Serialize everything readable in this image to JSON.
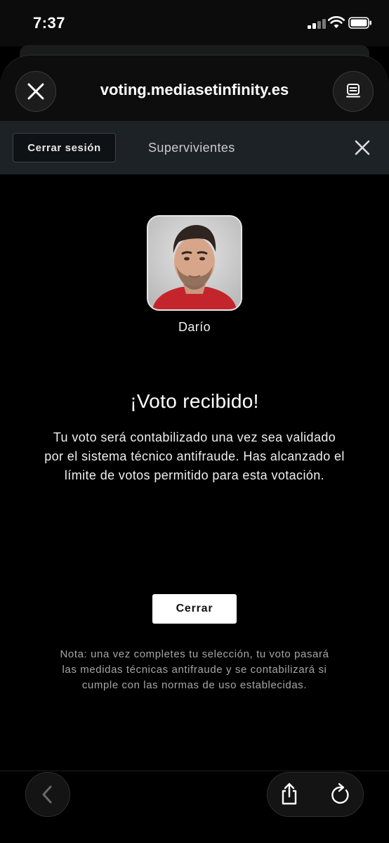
{
  "status_bar": {
    "time": "7:37"
  },
  "browser": {
    "url": "voting.mediasetinfinity.es"
  },
  "header": {
    "logout_label": "Cerrar sesión",
    "title": "Supervivientes"
  },
  "candidate": {
    "name": "Darío"
  },
  "result": {
    "title": "¡Voto recibido!",
    "message": "Tu voto será contabilizado una vez sea validado por el sistema técnico antifraude. Has alcanzado el límite de votos permitido para esta votación.",
    "close_label": "Cerrar",
    "note": "Nota: una vez completes tu selección, tu voto pasará las medidas técnicas antifraude y se contabilizará si cumple con las normas de uso establecidas."
  },
  "icons": {
    "close": "close-icon",
    "reader": "reader-mode-icon",
    "back": "chevron-left-icon",
    "share": "share-icon",
    "reload": "reload-icon"
  },
  "colors": {
    "background": "#000000",
    "header_bar": "#1d2226",
    "button": "#ffffff"
  }
}
